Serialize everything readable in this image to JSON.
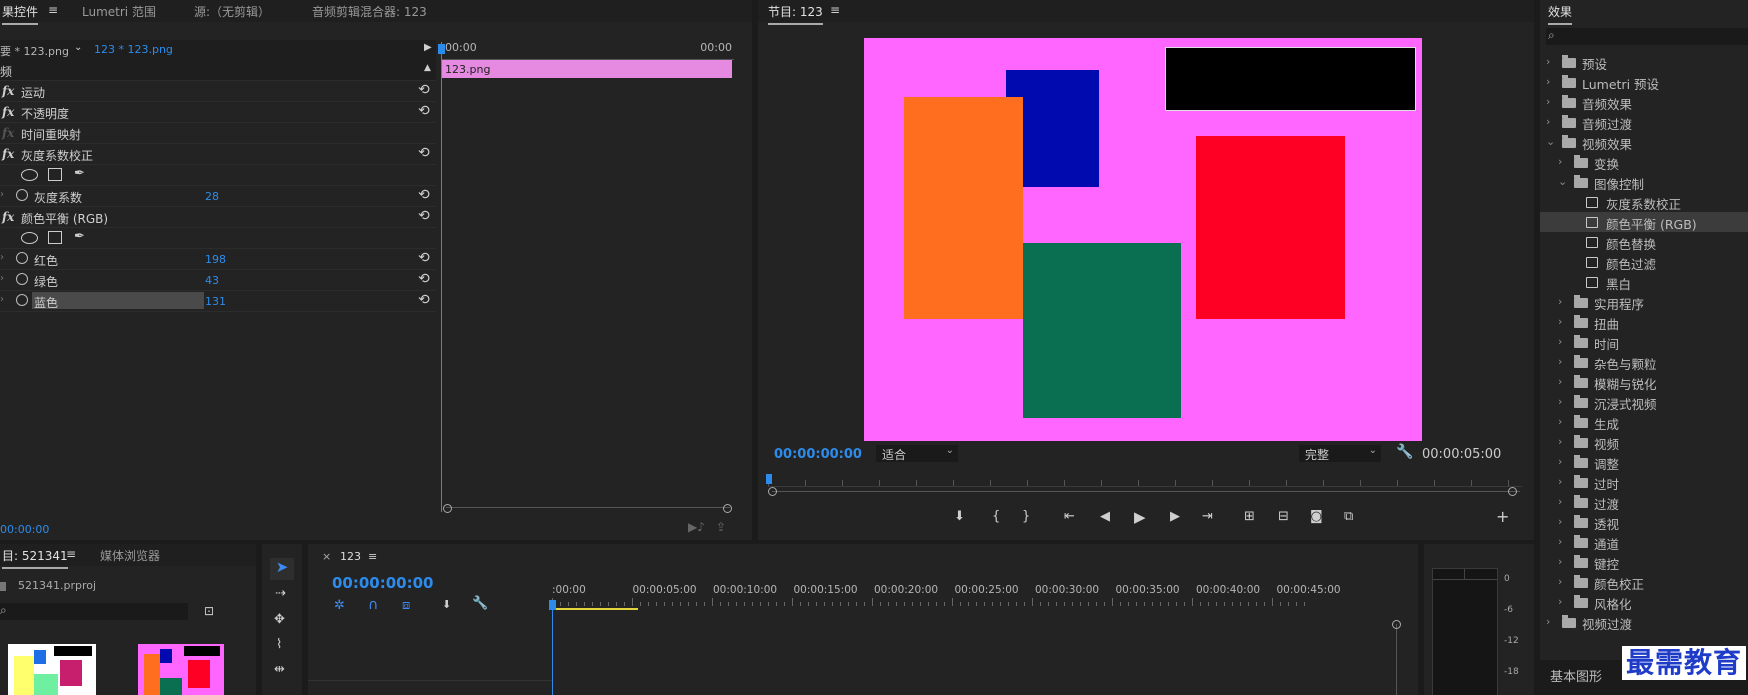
{
  "effect_controls": {
    "tab_active": "果控件",
    "tab_lumetri": "Lumetri 范围",
    "tab_source": "源:（无剪辑）",
    "tab_mixer": "音频剪辑混合器: 123",
    "master_label": "要 * 123.png",
    "clip_label": "123 * 123.png",
    "time_start": "00:00",
    "time_end": "00:00",
    "clip_name": "123.png",
    "section": "频",
    "effects": [
      {
        "name": "运动"
      },
      {
        "name": "不透明度"
      },
      {
        "name": "时间重映射"
      },
      {
        "name": "灰度系数校正"
      },
      {
        "name": "颜色平衡 (RGB)"
      }
    ],
    "params": {
      "gamma": {
        "name": "灰度系数",
        "value": "28"
      },
      "red": {
        "name": "红色",
        "value": "198"
      },
      "green": {
        "name": "绿色",
        "value": "43"
      },
      "blue": {
        "name": "蓝色",
        "value": "131"
      }
    },
    "timecode": "00:00:00"
  },
  "program": {
    "title": "节目: 123",
    "timecode": "00:00:00:00",
    "fit": "适合",
    "quality": "完整",
    "duration": "00:00:05:00",
    "colors": {
      "bg": "#ff66ff",
      "black": "#000000",
      "navy": "#000aaf",
      "orange": "#ff6e1e",
      "red": "#ff0025",
      "green": "#096f50"
    }
  },
  "effects_panel": {
    "title": "效果",
    "items": [
      {
        "label": "预设",
        "level": 0,
        "expanded": false
      },
      {
        "label": "Lumetri 预设",
        "level": 0,
        "expanded": false
      },
      {
        "label": "音频效果",
        "level": 0,
        "expanded": false
      },
      {
        "label": "音频过渡",
        "level": 0,
        "expanded": false
      },
      {
        "label": "视频效果",
        "level": 0,
        "expanded": true
      },
      {
        "label": "变换",
        "level": 1,
        "expanded": false
      },
      {
        "label": "图像控制",
        "level": 1,
        "expanded": true
      },
      {
        "label": "灰度系数校正",
        "level": 2,
        "effect": true
      },
      {
        "label": "颜色平衡 (RGB)",
        "level": 2,
        "effect": true,
        "selected": true
      },
      {
        "label": "颜色替换",
        "level": 2,
        "effect": true
      },
      {
        "label": "颜色过滤",
        "level": 2,
        "effect": true
      },
      {
        "label": "黑白",
        "level": 2,
        "effect": true
      },
      {
        "label": "实用程序",
        "level": 1
      },
      {
        "label": "扭曲",
        "level": 1
      },
      {
        "label": "时间",
        "level": 1
      },
      {
        "label": "杂色与颗粒",
        "level": 1
      },
      {
        "label": "模糊与锐化",
        "level": 1
      },
      {
        "label": "沉浸式视频",
        "level": 1
      },
      {
        "label": "生成",
        "level": 1
      },
      {
        "label": "视频",
        "level": 1
      },
      {
        "label": "调整",
        "level": 1
      },
      {
        "label": "过时",
        "level": 1
      },
      {
        "label": "过渡",
        "level": 1
      },
      {
        "label": "透视",
        "level": 1
      },
      {
        "label": "通道",
        "level": 1
      },
      {
        "label": "键控",
        "level": 1
      },
      {
        "label": "颜色校正",
        "level": 1
      },
      {
        "label": "风格化",
        "level": 1
      },
      {
        "label": "视频过渡",
        "level": 0
      }
    ],
    "bottom_tab": "基本图形",
    "watermark": "最需教育"
  },
  "project": {
    "tab_active": "目: 521341",
    "tab_media": "媒体浏览器",
    "file": "521341.prproj"
  },
  "timeline": {
    "tab": "123",
    "timecode": "00:00:00:00",
    "ruler": [
      ":00:00",
      "00:00:05:00",
      "00:00:10:00",
      "00:00:15:00",
      "00:00:20:00",
      "00:00:25:00",
      "00:00:30:00",
      "00:00:35:00",
      "00:00:40:00",
      "00:00:45:00"
    ]
  },
  "meter": {
    "labels": [
      "0",
      "-6",
      "-12",
      "-18"
    ]
  }
}
